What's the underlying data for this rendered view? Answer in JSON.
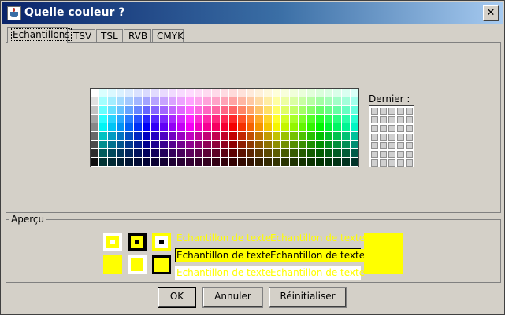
{
  "window": {
    "title": "Quelle couleur ?",
    "close_glyph": "✕"
  },
  "tabs": [
    {
      "label": "Echantillons",
      "active": true
    },
    {
      "label": "TSV",
      "active": false
    },
    {
      "label": "TSL",
      "active": false
    },
    {
      "label": "RVB",
      "active": false
    },
    {
      "label": "CMYK",
      "active": false
    }
  ],
  "swatches": {
    "columns": 31,
    "rows": 9,
    "recent_label": "Dernier :",
    "recent_columns": 5,
    "recent_rows": 7
  },
  "preview": {
    "legend": "Aperçu",
    "selected_color": "#ffff00",
    "sample_text": "Echantillon de texte"
  },
  "buttons": {
    "ok": "OK",
    "cancel": "Annuler",
    "reset": "Réinitialiser"
  }
}
